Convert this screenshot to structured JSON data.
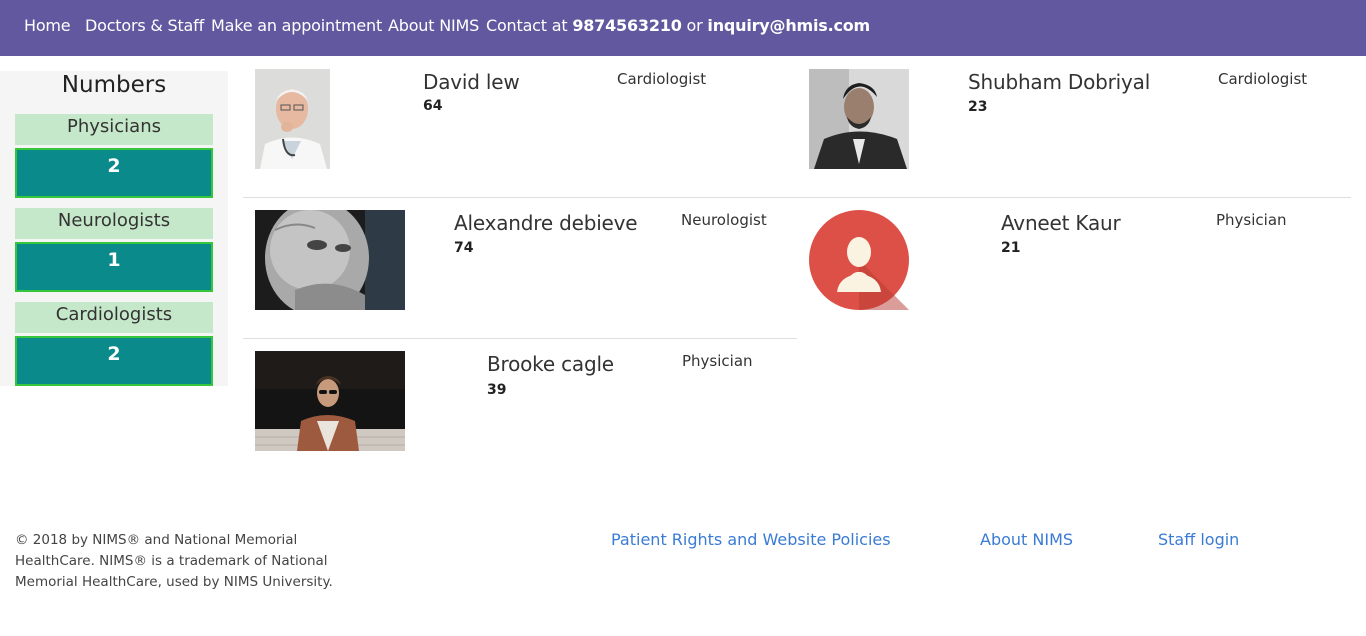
{
  "nav": {
    "home": "Home",
    "doctors": "Doctors & Staff",
    "appointment": "Make an appointment",
    "about": "About NIMS",
    "contact_prefix": "Contact at",
    "phone": "9874563210",
    "or": "or",
    "email": "inquiry@hmis.com"
  },
  "sidebar": {
    "title": "Numbers",
    "stats": [
      {
        "label": "Physicians",
        "value": "2"
      },
      {
        "label": "Neurologists",
        "value": "1"
      },
      {
        "label": "Cardiologists",
        "value": "2"
      }
    ]
  },
  "doctors": [
    {
      "name": "David lew",
      "number": "64",
      "specialty": "Cardiologist",
      "photo": "elderly-doctor-photo"
    },
    {
      "name": "Shubham Dobriyal",
      "number": "23",
      "specialty": "Cardiologist",
      "photo": "man-portrait-photo"
    },
    {
      "name": "Alexandre debieve",
      "number": "74",
      "specialty": "Neurologist",
      "photo": "old-man-bw-photo"
    },
    {
      "name": "Avneet Kaur",
      "number": "21",
      "specialty": "Physician",
      "photo": "default-avatar"
    },
    {
      "name": "Brooke cagle",
      "number": "39",
      "specialty": "Physician",
      "photo": "man-sunglasses-photo"
    }
  ],
  "footer": {
    "copyright": "© 2018 by NIMS® and National Memorial HealthCare. NIMS® is a trademark of National Memorial HealthCare, used by NIMS University.",
    "links": {
      "policies": "Patient Rights and Website Policies",
      "about": "About NIMS",
      "staff_login": "Staff login"
    }
  },
  "colors": {
    "navbar": "#62589f",
    "stat_label_bg": "#c6e8ca",
    "stat_value_bg": "#0a8a8a",
    "stat_value_border": "#35c63c",
    "link": "#3a7bd5",
    "avatar_bg": "#dd5047"
  }
}
